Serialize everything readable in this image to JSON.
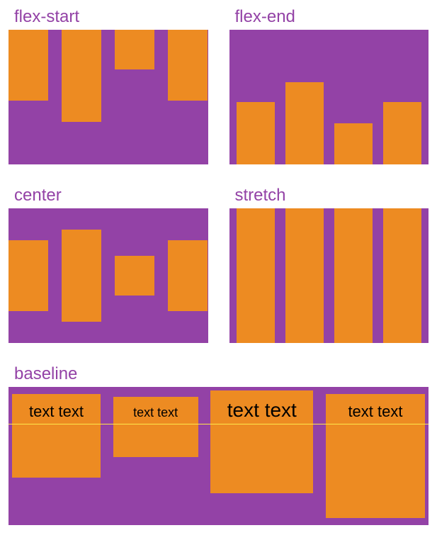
{
  "labels": {
    "flexStart": "flex-start",
    "flexEnd": "flex-end",
    "center": "center",
    "stretch": "stretch",
    "baseline": "baseline"
  },
  "baselineText": "text text",
  "colors": {
    "container": "#9342a6",
    "box": "#ed8b22",
    "label": "#9342a6",
    "baselineLine": "#ffe84a"
  }
}
